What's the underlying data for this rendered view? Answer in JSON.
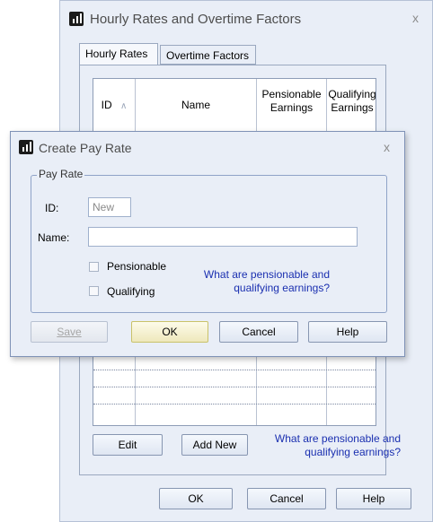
{
  "main_window": {
    "title": "Hourly Rates and Overtime Factors",
    "close_label": "x",
    "tabs": [
      {
        "label": "Hourly Rates",
        "active": true
      },
      {
        "label": "Overtime Factors",
        "active": false
      }
    ],
    "grid": {
      "columns": [
        {
          "line1": "ID",
          "line2": ""
        },
        {
          "line1": "Name",
          "line2": ""
        },
        {
          "line1": "Pensionable",
          "line2": "Earnings"
        },
        {
          "line1": "Qualifying",
          "line2": "Earnings"
        }
      ],
      "sort_indicator": "∧"
    },
    "buttons": {
      "edit": "Edit",
      "add_new": "Add New",
      "ok": "OK",
      "cancel": "Cancel",
      "help": "Help"
    },
    "link_line1": "What are pensionable and",
    "link_line2": "qualifying earnings?"
  },
  "dialog": {
    "title": "Create Pay Rate",
    "close_label": "x",
    "group_label": "Pay Rate",
    "id_label": "ID:",
    "id_value": "New",
    "name_label": "Name:",
    "name_value": "",
    "pensionable_label": "Pensionable",
    "qualifying_label": "Qualifying",
    "link_line1": "What are pensionable and",
    "link_line2": "qualifying earnings?",
    "buttons": {
      "save": "Save",
      "ok": "OK",
      "cancel": "Cancel",
      "help": "Help"
    }
  },
  "colors": {
    "window_bg": "#e9eef7",
    "link": "#1a2fb0",
    "default_button": "#eee8bc"
  }
}
